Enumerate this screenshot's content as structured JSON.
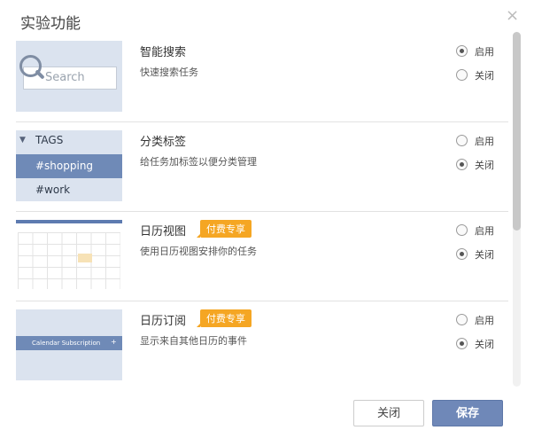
{
  "dialog": {
    "title": "实验功能",
    "close_icon": "×",
    "features": [
      {
        "name": "智能搜索",
        "description": "快速搜索任务",
        "badge": "",
        "thumbnail": {
          "type": "search",
          "placeholder": "Search"
        },
        "options": [
          "启用",
          "关闭"
        ],
        "selected": "启用"
      },
      {
        "name": "分类标签",
        "description": "给任务加标签以便分类管理",
        "badge": "",
        "thumbnail": {
          "type": "tags",
          "header": "TAGS",
          "tags": [
            "#shopping",
            "#work"
          ]
        },
        "options": [
          "启用",
          "关闭"
        ],
        "selected": "关闭"
      },
      {
        "name": "日历视图",
        "description": "使用日历视图安排你的任务",
        "badge": "付费专享",
        "thumbnail": {
          "type": "calendar"
        },
        "options": [
          "启用",
          "关闭"
        ],
        "selected": "关闭"
      },
      {
        "name": "日历订阅",
        "description": "显示来自其他日历的事件",
        "badge": "付费专享",
        "thumbnail": {
          "type": "subscription",
          "label": "Calendar Subscription"
        },
        "options": [
          "启用",
          "关闭"
        ],
        "selected": "关闭"
      }
    ],
    "buttons": {
      "close_label": "关闭",
      "save_label": "保存"
    },
    "colors": {
      "badge": "#f5a623",
      "primary": "#6f88b8",
      "tag_highlight": "#6f8ab7"
    }
  }
}
